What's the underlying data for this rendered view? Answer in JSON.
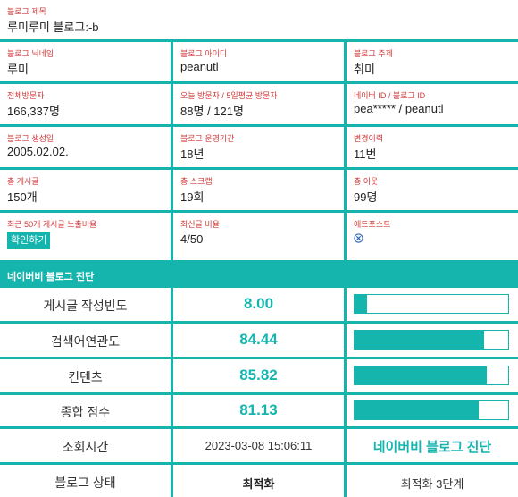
{
  "blog_title": {
    "label": "블로그 제목",
    "value": "루미루미 블로그:-b"
  },
  "info_grid": [
    {
      "label": "블로그 닉네임",
      "value": "루미"
    },
    {
      "label": "블로그 아이디",
      "value": "peanutl"
    },
    {
      "label": "블로그 주제",
      "value": "취미"
    },
    {
      "label": "전체방문자",
      "value": "166,337명"
    },
    {
      "label": "오늘 방문자 / 5일평균 방문자",
      "value": "88명 / 121명"
    },
    {
      "label": "네이버 ID / 블로그 ID",
      "value": "pea***** / peanutl"
    },
    {
      "label": "블로그 생성일",
      "value": "2005.02.02."
    },
    {
      "label": "블로그 운영기간",
      "value": "18년"
    },
    {
      "label": "변경이력",
      "value": "11번"
    },
    {
      "label": "총 게시글",
      "value": "150개"
    },
    {
      "label": "총 스크랩",
      "value": "19회"
    },
    {
      "label": "총 이웃",
      "value": "99명"
    }
  ],
  "last_row": {
    "exposure": {
      "label": "최근 50개 게시글 노출비율",
      "button": "확인하기"
    },
    "recent_ratio": {
      "label": "최신글 비율",
      "value": "4/50"
    },
    "adpost": {
      "label": "애드포스트",
      "icon": "x-circle-icon"
    }
  },
  "diagnosis": {
    "header": "네이버비 블로그 진단",
    "metrics": [
      {
        "label": "게시글 작성빈도",
        "score": "8.00",
        "fill": 0.08
      },
      {
        "label": "검색어연관도",
        "score": "84.44",
        "fill": 0.844
      },
      {
        "label": "컨텐츠",
        "score": "85.82",
        "fill": 0.858
      },
      {
        "label": "종합 점수",
        "score": "81.13",
        "fill": 0.811
      }
    ],
    "lookup_label": "조회시간",
    "lookup_time": "2023-03-08 15:06:11",
    "link_text": "네이버비 블로그 진단",
    "state_label": "블로그 상태",
    "state_value": "최적화",
    "state_level": "최적화 3단계"
  },
  "colors": {
    "accent": "#15b5ae",
    "label_red": "#d23a3a"
  }
}
